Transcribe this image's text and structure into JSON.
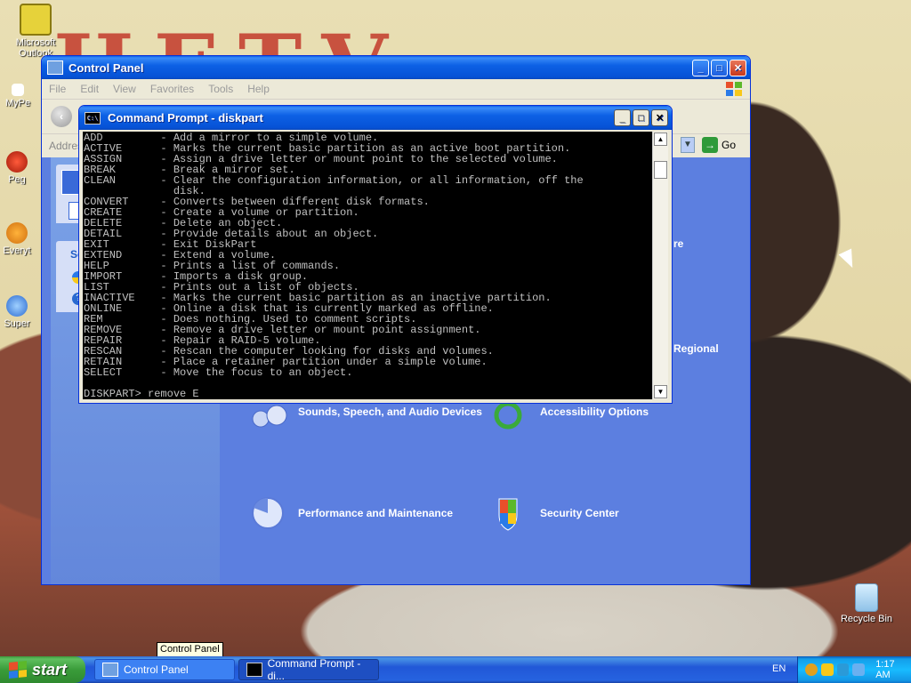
{
  "desktop": {
    "icons": [
      {
        "label": "Microsoft Outlook",
        "icon": "outlook-icon"
      },
      {
        "label": "MyPe",
        "icon": "shortcut-icon"
      },
      {
        "label": "Peg",
        "icon": "shortcut-icon"
      },
      {
        "label": "Everyt",
        "icon": "shortcut-icon"
      },
      {
        "label": "Super",
        "icon": "shortcut-icon"
      },
      {
        "label": "Recycle Bin",
        "icon": "recycle-bin-icon"
      }
    ]
  },
  "control_panel": {
    "title": "Control Panel",
    "menu": [
      "File",
      "Edit",
      "View",
      "Favorites",
      "Tools",
      "Help"
    ],
    "address_label": "Addres",
    "go_label": "Go",
    "left_fragments": {
      "see_also": "Se"
    },
    "categories": [
      {
        "label": "Sounds, Speech, and Audio Devices",
        "icon": "speaker-icon"
      },
      {
        "label": "Accessibility Options",
        "icon": "accessibility-icon"
      },
      {
        "label": "Performance and Maintenance",
        "icon": "performance-icon"
      },
      {
        "label": "Security Center",
        "icon": "security-shield-icon"
      }
    ],
    "partial_labels": {
      "regional": "Regional",
      "re": "re"
    }
  },
  "command_prompt": {
    "title": "Command Prompt - diskpart",
    "lines": [
      "ADD         - Add a mirror to a simple volume.",
      "ACTIVE      - Marks the current basic partition as an active boot partition.",
      "ASSIGN      - Assign a drive letter or mount point to the selected volume.",
      "BREAK       - Break a mirror set.",
      "CLEAN       - Clear the configuration information, or all information, off the",
      "              disk.",
      "CONVERT     - Converts between different disk formats.",
      "CREATE      - Create a volume or partition.",
      "DELETE      - Delete an object.",
      "DETAIL      - Provide details about an object.",
      "EXIT        - Exit DiskPart",
      "EXTEND      - Extend a volume.",
      "HELP        - Prints a list of commands.",
      "IMPORT      - Imports a disk group.",
      "LIST        - Prints out a list of objects.",
      "INACTIVE    - Marks the current basic partition as an inactive partition.",
      "ONLINE      - Online a disk that is currently marked as offline.",
      "REM         - Does nothing. Used to comment scripts.",
      "REMOVE      - Remove a drive letter or mount point assignment.",
      "REPAIR      - Repair a RAID-5 volume.",
      "RESCAN      - Rescan the computer looking for disks and volumes.",
      "RETAIN      - Place a retainer partition under a simple volume.",
      "SELECT      - Move the focus to an object.",
      "",
      "DISKPART> remove E"
    ]
  },
  "tooltip": "Control Panel",
  "taskbar": {
    "start_label": "start",
    "tasks": [
      {
        "label": "Control Panel",
        "active": false
      },
      {
        "label": "Command Prompt - di...",
        "active": true
      }
    ],
    "language": "EN",
    "clock": "1:17 AM"
  },
  "colors": {
    "xp_blue": "#0a5fe8",
    "start_green": "#3a9c3a",
    "console_bg": "#000000",
    "console_fg": "#c0c0c0",
    "cp_body": "#5c7fe0"
  }
}
